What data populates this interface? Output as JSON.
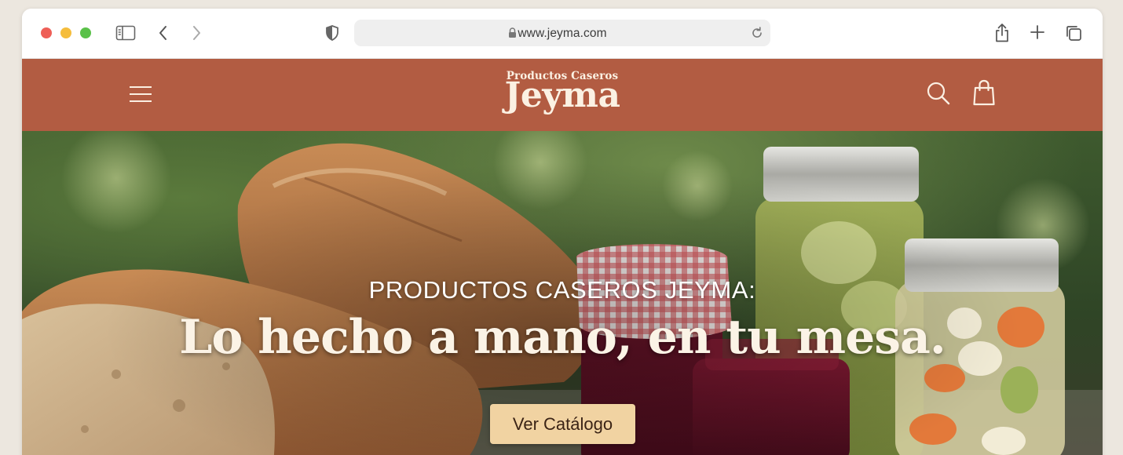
{
  "browser": {
    "url": "www.jeyma.com",
    "icons": [
      "sidebar-icon",
      "back-icon",
      "forward-icon",
      "shield-icon",
      "lock-icon",
      "reload-icon",
      "share-icon",
      "new-tab-icon",
      "tabs-overview-icon"
    ]
  },
  "site": {
    "brand_sub": "Productos Caseros",
    "brand_name": "Jeyma",
    "header_color": "#b25c42",
    "icons": [
      "menu-icon",
      "search-icon",
      "shopping-bag-icon"
    ]
  },
  "hero": {
    "kicker": "PRODUCTOS CASEROS JEYMA:",
    "title": "Lo hecho a mano, en tu mesa.",
    "cta_label": "Ver Catálogo",
    "cta_color": "#f1d3a2"
  }
}
